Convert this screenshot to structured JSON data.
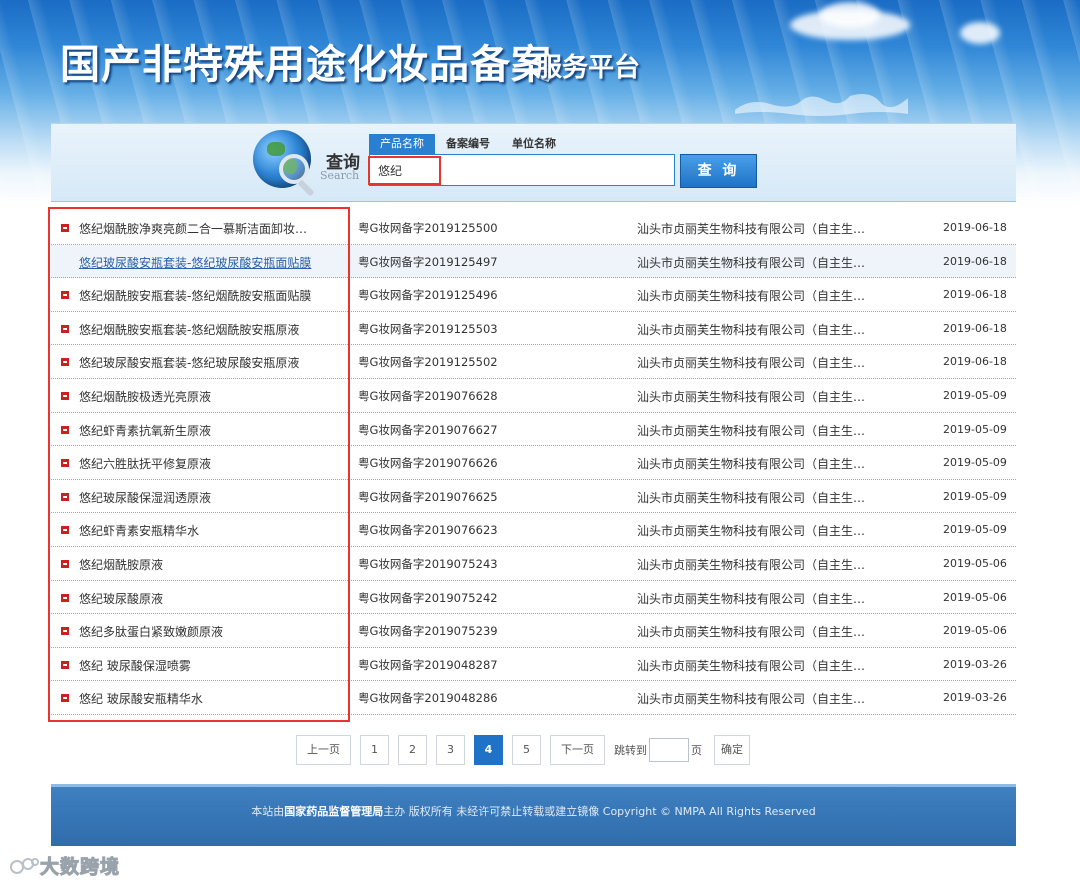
{
  "header": {
    "title": "国产非特殊用途化妆品备案",
    "subtitle": "服务平台"
  },
  "search": {
    "label_zh": "查询",
    "label_en": "Search",
    "tabs": [
      "产品名称",
      "备案编号",
      "单位名称"
    ],
    "active_tab": "产品名称",
    "query": "悠纪",
    "button_label": "查 询"
  },
  "results": [
    {
      "name": "悠纪烟酰胺净爽亮颜二合一慕斯洁面卸妆…",
      "regno": "粤G妆网备字2019125500",
      "company": "汕头市贞丽芙生物科技有限公司（自主生…",
      "date": "2019-06-18"
    },
    {
      "name": "悠纪玻尿酸安瓶套装-悠纪玻尿酸安瓶面贴膜",
      "regno": "粤G妆网备字2019125497",
      "company": "汕头市贞丽芙生物科技有限公司（自主生…",
      "date": "2019-06-18"
    },
    {
      "name": "悠纪烟酰胺安瓶套装-悠纪烟酰胺安瓶面贴膜",
      "regno": "粤G妆网备字2019125496",
      "company": "汕头市贞丽芙生物科技有限公司（自主生…",
      "date": "2019-06-18"
    },
    {
      "name": "悠纪烟酰胺安瓶套装-悠纪烟酰胺安瓶原液",
      "regno": "粤G妆网备字2019125503",
      "company": "汕头市贞丽芙生物科技有限公司（自主生…",
      "date": "2019-06-18"
    },
    {
      "name": "悠纪玻尿酸安瓶套装-悠纪玻尿酸安瓶原液",
      "regno": "粤G妆网备字2019125502",
      "company": "汕头市贞丽芙生物科技有限公司（自主生…",
      "date": "2019-06-18"
    },
    {
      "name": "悠纪烟酰胺极透光亮原液",
      "regno": "粤G妆网备字2019076628",
      "company": "汕头市贞丽芙生物科技有限公司（自主生…",
      "date": "2019-05-09"
    },
    {
      "name": "悠纪虾青素抗氧新生原液",
      "regno": "粤G妆网备字2019076627",
      "company": "汕头市贞丽芙生物科技有限公司（自主生…",
      "date": "2019-05-09"
    },
    {
      "name": "悠纪六胜肽抚平修复原液",
      "regno": "粤G妆网备字2019076626",
      "company": "汕头市贞丽芙生物科技有限公司（自主生…",
      "date": "2019-05-09"
    },
    {
      "name": "悠纪玻尿酸保湿润透原液",
      "regno": "粤G妆网备字2019076625",
      "company": "汕头市贞丽芙生物科技有限公司（自主生…",
      "date": "2019-05-09"
    },
    {
      "name": "悠纪虾青素安瓶精华水",
      "regno": "粤G妆网备字2019076623",
      "company": "汕头市贞丽芙生物科技有限公司（自主生…",
      "date": "2019-05-09"
    },
    {
      "name": "悠纪烟酰胺原液",
      "regno": "粤G妆网备字2019075243",
      "company": "汕头市贞丽芙生物科技有限公司（自主生…",
      "date": "2019-05-06"
    },
    {
      "name": "悠纪玻尿酸原液",
      "regno": "粤G妆网备字2019075242",
      "company": "汕头市贞丽芙生物科技有限公司（自主生…",
      "date": "2019-05-06"
    },
    {
      "name": "悠纪多肽蛋白紧致嫩颜原液",
      "regno": "粤G妆网备字2019075239",
      "company": "汕头市贞丽芙生物科技有限公司（自主生…",
      "date": "2019-05-06"
    },
    {
      "name": "悠纪 玻尿酸保湿喷雾",
      "regno": "粤G妆网备字2019048287",
      "company": "汕头市贞丽芙生物科技有限公司（自主生…",
      "date": "2019-03-26"
    },
    {
      "name": "悠纪 玻尿酸安瓶精华水",
      "regno": "粤G妆网备字2019048286",
      "company": "汕头市贞丽芙生物科技有限公司（自主生…",
      "date": "2019-03-26"
    }
  ],
  "pagination": {
    "prev": "上一页",
    "pages": [
      "1",
      "2",
      "3",
      "4",
      "5"
    ],
    "current": "4",
    "next": "下一页",
    "jump_label": "跳转到",
    "jump_value": "",
    "page_unit": "页",
    "confirm": "确定"
  },
  "footer": {
    "prefix": "本站由",
    "agency": "国家药品监督管理局",
    "suffix": "主办 版权所有 未经许可禁止转载或建立镜像 Copyright © NMPA All Rights Reserved"
  },
  "watermark": {
    "text": "大数跨境"
  },
  "colors": {
    "accent": "#1f72c6",
    "highlight_box": "#e8352e",
    "bullet": "#cc1f1f",
    "footer_bg": "#2f6cac"
  }
}
